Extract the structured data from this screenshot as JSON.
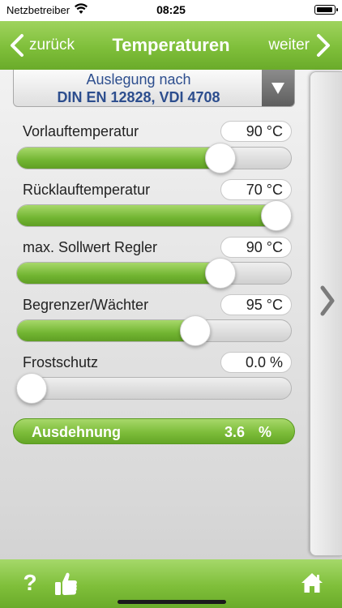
{
  "status_bar": {
    "carrier": "Netzbetreiber",
    "time": "08:25"
  },
  "nav": {
    "back_label": "zurück",
    "title": "Temperaturen",
    "next_label": "weiter"
  },
  "dropdown": {
    "line1": "Auslegung nach",
    "line2": "DIN EN 12828, VDI 4708"
  },
  "rows": [
    {
      "label": "Vorlauftemperatur",
      "value": "90 °C",
      "level": 0.77
    },
    {
      "label": "Rücklauftemperatur",
      "value": "70 °C",
      "level": 1.0
    },
    {
      "label": "max. Sollwert Regler",
      "value": "90 °C",
      "level": 0.77
    },
    {
      "label": "Begrenzer/Wächter",
      "value": "95 °C",
      "level": 0.67
    },
    {
      "label": "Frostschutz",
      "value": "0.0  %",
      "level": 0.0
    }
  ],
  "summary": {
    "label": "Ausdehnung",
    "value": "3.6",
    "unit": "%"
  },
  "toolbar": {
    "help_label": "?"
  },
  "colors": {
    "accent_green": "#7fbf3a",
    "dropdown_text": "#2d4e8e"
  },
  "icons": [
    "wifi-icon",
    "battery-icon",
    "back-chevron-icon",
    "next-chevron-icon",
    "dropdown-arrow-icon",
    "side-chevron-icon",
    "thumbs-up-icon",
    "home-icon"
  ]
}
